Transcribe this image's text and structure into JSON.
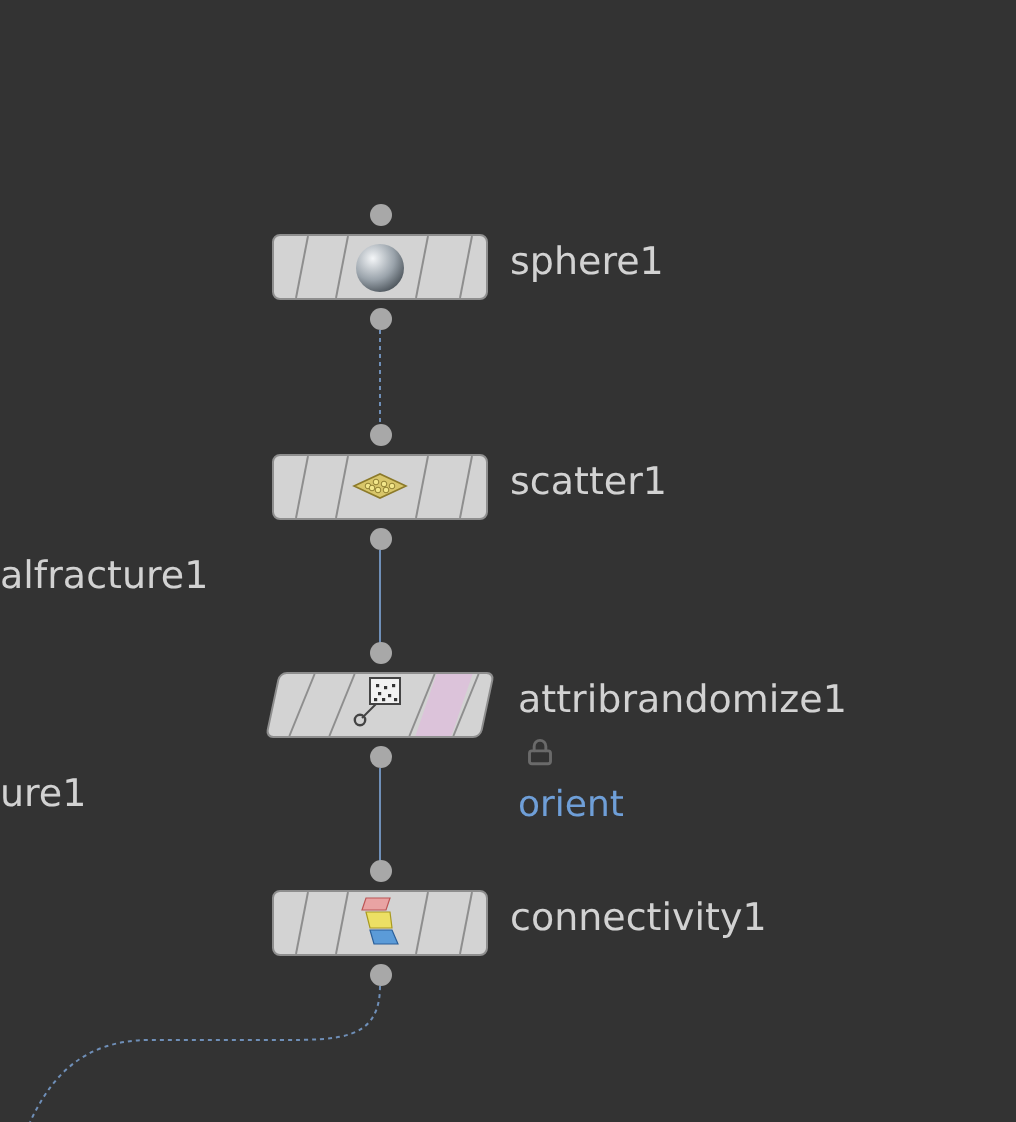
{
  "offscreen_labels": [
    "alfracture1",
    "ure1"
  ],
  "nodes": [
    {
      "name": "sphere1",
      "kind": "sphere",
      "locked": false
    },
    {
      "name": "scatter1",
      "kind": "scatter",
      "locked": false
    },
    {
      "name": "attribrandomize1",
      "kind": "attribrandomize",
      "locked": true,
      "note": "orient"
    },
    {
      "name": "connectivity1",
      "kind": "connectivity",
      "locked": false
    }
  ],
  "wires": [
    {
      "kind": "dotted"
    },
    {
      "kind": "solid"
    },
    {
      "kind": "solid"
    },
    {
      "kind": "dotted"
    }
  ]
}
